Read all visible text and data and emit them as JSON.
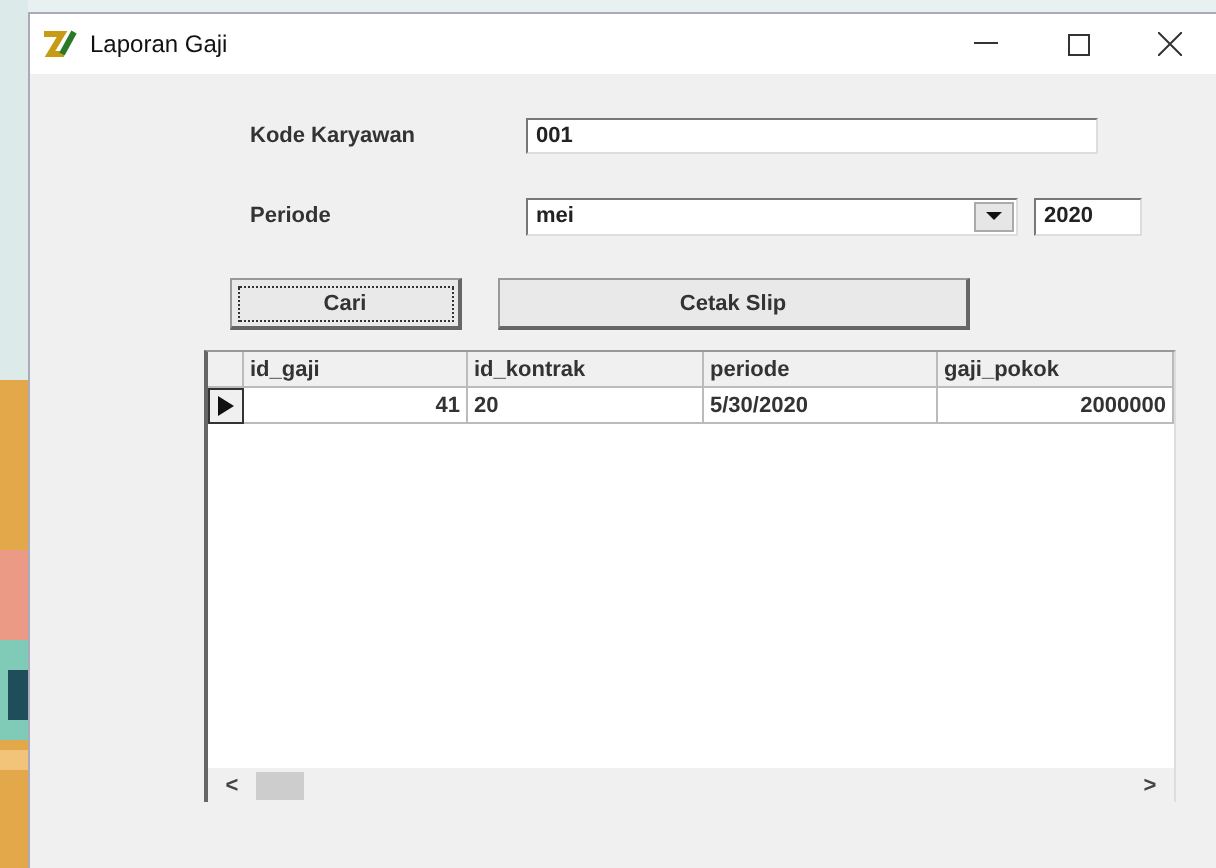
{
  "window": {
    "title": "Laporan Gaji"
  },
  "form": {
    "kode_label": "Kode Karyawan",
    "kode_value": "001",
    "periode_label": "Periode",
    "bulan_value": "mei",
    "tahun_value": "2020"
  },
  "buttons": [
    {
      "label": "Cari",
      "focused": true
    },
    {
      "label": "Cetak Slip",
      "focused": false
    }
  ],
  "table": {
    "columns": [
      "id_gaji",
      "id_kontrak",
      "periode",
      "gaji_pokok"
    ],
    "rows": [
      {
        "selected": true,
        "cells": [
          "41",
          "20",
          "5/30/2020",
          "2000000"
        ]
      }
    ],
    "scroll_left": "<",
    "scroll_right": ">"
  }
}
